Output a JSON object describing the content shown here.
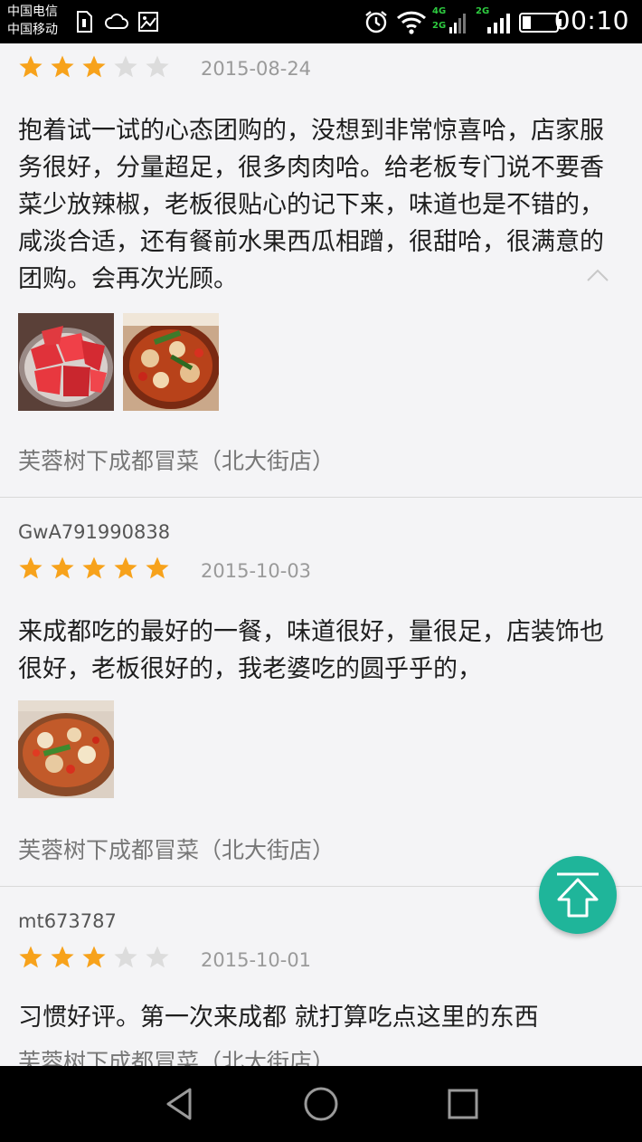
{
  "status_bar": {
    "carrier_1": "中国电信",
    "carrier_2": "中国移动",
    "net_1": "4G",
    "net_2": "2G",
    "net_3": "2G",
    "time": "00:10"
  },
  "reviews": [
    {
      "username": "",
      "rating": 3,
      "max_rating": 5,
      "date": "2015-08-24",
      "text": "抱着试一试的心态团购的，没想到非常惊喜哈，店家服务很好，分量超足，很多肉肉哈。给老板专门说不要香菜少放辣椒，老板很贴心的记下来，味道也是不错的，咸淡合适，还有餐前水果西瓜相蹭，很甜哈，很满意的团购。会再次光顾。",
      "photos": [
        "watermelon-photo",
        "spicy-dish-photo"
      ],
      "shop": "芙蓉树下成都冒菜（北大街店）"
    },
    {
      "username": "GwA791990838",
      "rating": 5,
      "max_rating": 5,
      "date": "2015-10-03",
      "text": "来成都吃的最好的一餐，味道很好，量很足，店装饰也很好，老板很好的，我老婆吃的圆乎乎的，",
      "photos": [
        "dish-photo"
      ],
      "shop": "芙蓉树下成都冒菜（北大街店）"
    },
    {
      "username": "mt673787",
      "rating": 3,
      "max_rating": 5,
      "date": "2015-10-01",
      "text": "习惯好评。第一次来成都 就打算吃点这里的东西",
      "photos": [],
      "shop": "芙蓉树下成都冒菜（北大街店）"
    }
  ],
  "colors": {
    "star_on": "#f7a21b",
    "star_off": "#dcdcdc",
    "fab": "#1fb59a",
    "background": "#f4f4f6"
  },
  "icons": {
    "collapse": "chevron-up-icon",
    "fab": "back-to-top-icon",
    "nav_back": "back-triangle-icon",
    "nav_home": "home-circle-icon",
    "nav_recent": "recent-square-icon"
  }
}
